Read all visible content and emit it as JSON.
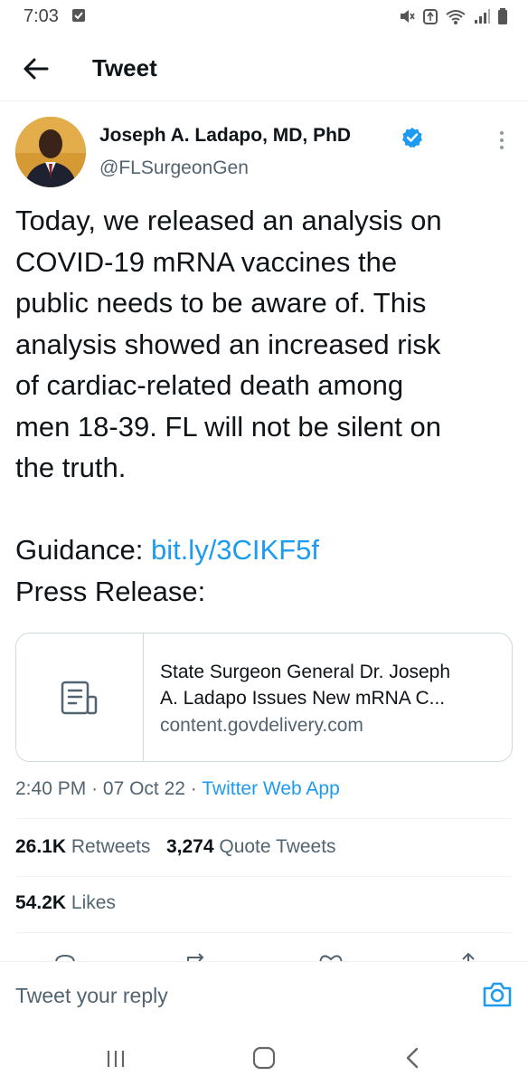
{
  "status_bar": {
    "time": "7:03"
  },
  "header": {
    "title": "Tweet"
  },
  "tweet": {
    "author_name": "Joseph A. Ladapo, MD, PhD",
    "handle": "@FLSurgeonGen",
    "text_lines": [
      "Today, we released an analysis on",
      "COVID-19 mRNA vaccines the",
      "public needs to be aware of. This",
      "analysis showed an increased risk",
      "of cardiac-related death among",
      "men 18-39. FL will not be silent on",
      "the truth."
    ],
    "guidance_label": "Guidance:",
    "guidance_link": "bit.ly/3CIKF5f",
    "press_release_label": "Press Release:"
  },
  "card": {
    "title_line1": "State Surgeon General Dr. Joseph",
    "title_line2": "A. Ladapo Issues New mRNA C...",
    "domain": "content.govdelivery.com"
  },
  "meta": {
    "time": "2:40 PM",
    "date": "07 Oct 22",
    "source": "Twitter Web App"
  },
  "stats": {
    "retweets_count": "26.1K",
    "retweets_label": "Retweets",
    "quotes_count": "3,274",
    "quotes_label": "Quote Tweets",
    "likes_count": "54.2K",
    "likes_label": "Likes"
  },
  "reply": {
    "placeholder": "Tweet your reply"
  },
  "colors": {
    "accent": "#1d9bf0",
    "text": "#0f1419",
    "secondary": "#536471",
    "border": "#cfd9de"
  }
}
